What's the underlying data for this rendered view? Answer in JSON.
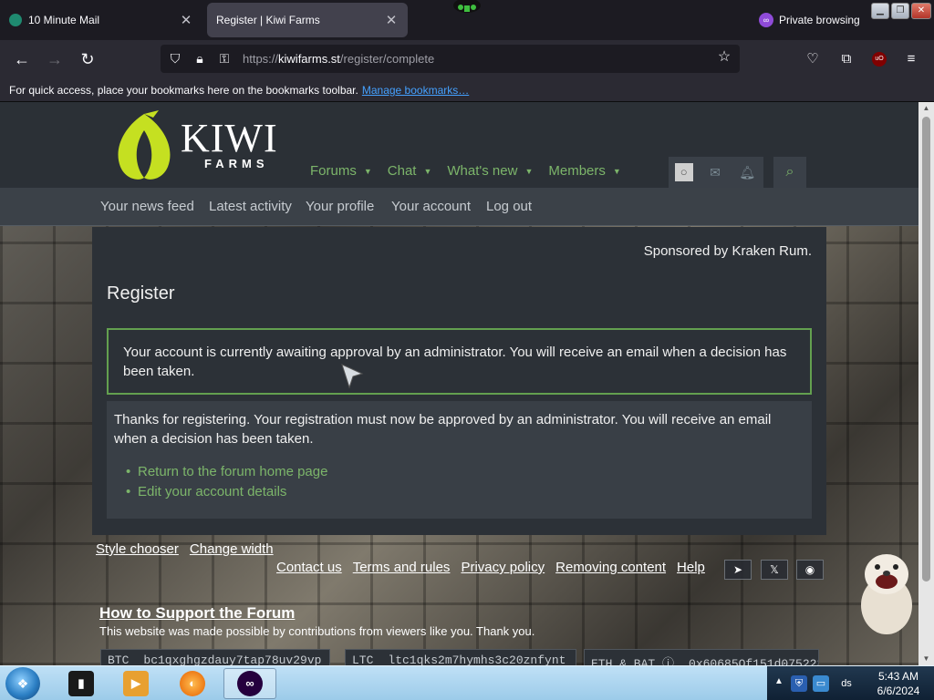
{
  "browser": {
    "tabs": [
      {
        "title": "10 Minute Mail",
        "active": false
      },
      {
        "title": "Register | Kiwi Farms",
        "active": true
      }
    ],
    "tab_close_glyph": "✕",
    "private_label": "Private browsing",
    "url_scheme": "https://",
    "url_domain": "kiwifarms.st",
    "url_path": "/register/complete",
    "bookmarks_text": "For quick access, place your bookmarks here on the bookmarks toolbar.",
    "bookmarks_link": "Manage bookmarks…",
    "extension_badge": "uO"
  },
  "site": {
    "logo_word": "KIWI",
    "logo_sub": "FARMS",
    "brand_green": "#c5e021",
    "link_green": "#7cb56a",
    "nav": [
      {
        "label": "Forums"
      },
      {
        "label": "Chat"
      },
      {
        "label": "What's new"
      },
      {
        "label": "Members"
      }
    ],
    "subnav": [
      {
        "label": "Your news feed"
      },
      {
        "label": "Latest activity"
      },
      {
        "label": "Your profile"
      },
      {
        "label": "Your account"
      },
      {
        "label": "Log out"
      }
    ]
  },
  "main": {
    "sponsor": "Sponsored by Kraken Rum.",
    "title": "Register",
    "notice": "Your account is currently awaiting approval by an administrator. You will receive an email when a decision has been taken.",
    "body": "Thanks for registering. Your registration must now be approved by an administrator. You will receive an email when a decision has been taken.",
    "links": [
      {
        "label": "Return to the forum home page"
      },
      {
        "label": "Edit your account details"
      }
    ]
  },
  "footer": {
    "row1": [
      {
        "label": "Style chooser"
      },
      {
        "label": "Change width"
      }
    ],
    "row2": [
      {
        "label": "Contact us"
      },
      {
        "label": "Terms and rules"
      },
      {
        "label": "Privacy policy"
      },
      {
        "label": "Removing content"
      },
      {
        "label": "Help"
      }
    ],
    "social": [
      {
        "icon": "telegram-icon",
        "glyph": "➤"
      },
      {
        "icon": "x-icon",
        "glyph": "𝕏"
      },
      {
        "icon": "rss-icon",
        "glyph": "◉"
      }
    ],
    "support_title": "How to Support the Forum",
    "support_text": "This website was made possible by contributions from viewers like you. Thank you.",
    "crypto": [
      {
        "label": "BTC",
        "addr": "bc1qxghgzdauy7tap78uv29vp"
      },
      {
        "label": "LTC",
        "addr": "ltc1qks2m7hymhs3c20znfynt"
      },
      {
        "label": "ETH & BAT ⓘ",
        "addr": "0x60685Of151d075223"
      }
    ]
  },
  "taskbar": {
    "start_glyph": "❖",
    "time": "5:43 AM",
    "date": "6/6/2024",
    "tray_text": "ds"
  }
}
